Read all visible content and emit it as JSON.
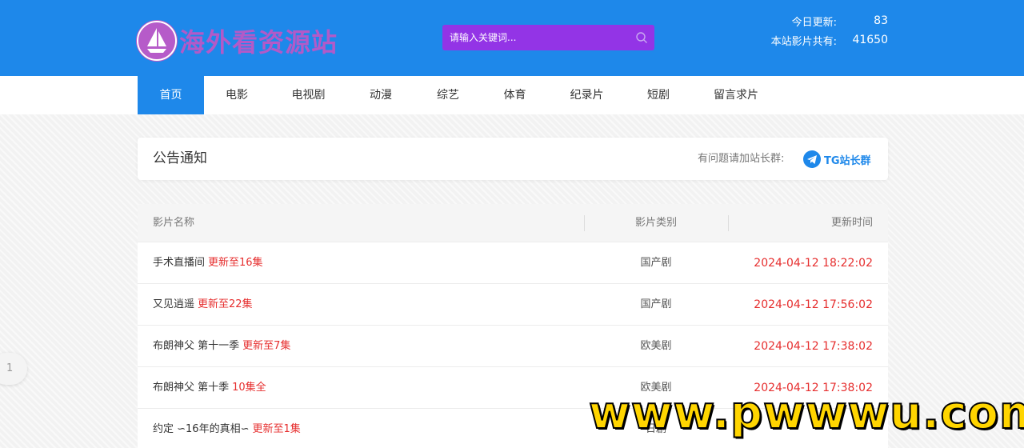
{
  "site": {
    "logo_text": "海外看资源站"
  },
  "search": {
    "placeholder": "请输入关键词..."
  },
  "stats": {
    "today_label": "今日更新:",
    "today_value": "83",
    "total_label": "本站影片共有:",
    "total_value": "41650"
  },
  "nav": {
    "items": [
      {
        "label": "首页",
        "active": true
      },
      {
        "label": "电影"
      },
      {
        "label": "电视剧"
      },
      {
        "label": "动漫"
      },
      {
        "label": "综艺"
      },
      {
        "label": "体育"
      },
      {
        "label": "纪录片"
      },
      {
        "label": "短剧"
      },
      {
        "label": "留言求片"
      }
    ]
  },
  "notice": {
    "title": "公告通知",
    "hint": "有问题请加站长群:",
    "tg_label": "TG站长群"
  },
  "table": {
    "headers": [
      "影片名称",
      "影片类别",
      "更新时间"
    ],
    "rows": [
      {
        "name": "手术直播间",
        "update": "更新至16集",
        "category": "国产剧",
        "time": "2024-04-12 18:22:02"
      },
      {
        "name": "又见逍遥",
        "update": "更新至22集",
        "category": "国产剧",
        "time": "2024-04-12 17:56:02"
      },
      {
        "name": "布朗神父 第十一季",
        "update": "更新至7集",
        "category": "欧美剧",
        "time": "2024-04-12 17:38:02"
      },
      {
        "name": "布朗神父 第十季",
        "update": "10集全",
        "category": "欧美剧",
        "time": "2024-04-12 17:38:02"
      },
      {
        "name": "约定 ∽16年的真相∽",
        "update": "更新至1集",
        "category": "日剧",
        "time": ""
      }
    ]
  },
  "pager": {
    "current": "1"
  },
  "watermark": {
    "text": "www.pwwwu.com"
  },
  "colors": {
    "header_bg": "#1e88ea",
    "search_bg": "#9334e6",
    "update_red": "#e62e2e",
    "logo_purple": "#b25ac8"
  }
}
